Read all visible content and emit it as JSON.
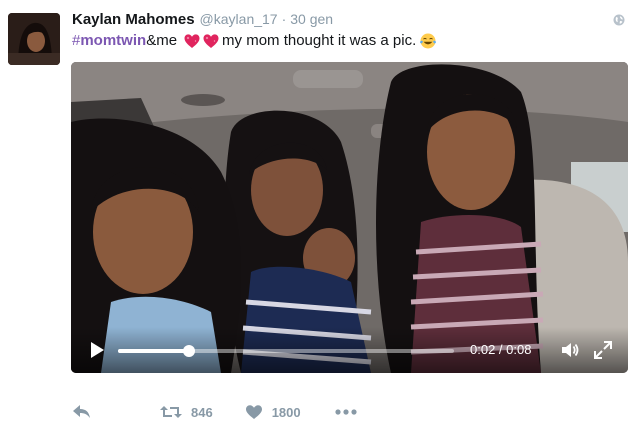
{
  "tweet": {
    "fullname": "Kaylan Mahomes",
    "handle": "@kaylan_17",
    "separator": "·",
    "date": "30 gen",
    "hash_symbol": "#",
    "hashtag": "momtwin",
    "text_after_hashtag": "&me",
    "text_after_emoji": "my mom thought it was a pic."
  },
  "icons": {
    "privacy": "globe-icon",
    "hearts": "sparkling-heart-emoji",
    "laugh": "tears-of-joy-emoji",
    "reply": "reply-icon",
    "retweet": "retweet-icon",
    "like": "heart-icon",
    "more": "more-icon",
    "play": "play-icon",
    "volume": "volume-icon",
    "fullscreen": "fullscreen-icon"
  },
  "video": {
    "current_time": "0:02",
    "duration": "0:08",
    "time_display": "0:02 / 0:08",
    "progress_fraction": 0.21
  },
  "stats": {
    "retweets": "846",
    "likes": "1800"
  },
  "colors": {
    "hashtag": "#7c57b2",
    "meta": "#8899a6",
    "text": "#14171a",
    "heart": "#e0245e"
  }
}
